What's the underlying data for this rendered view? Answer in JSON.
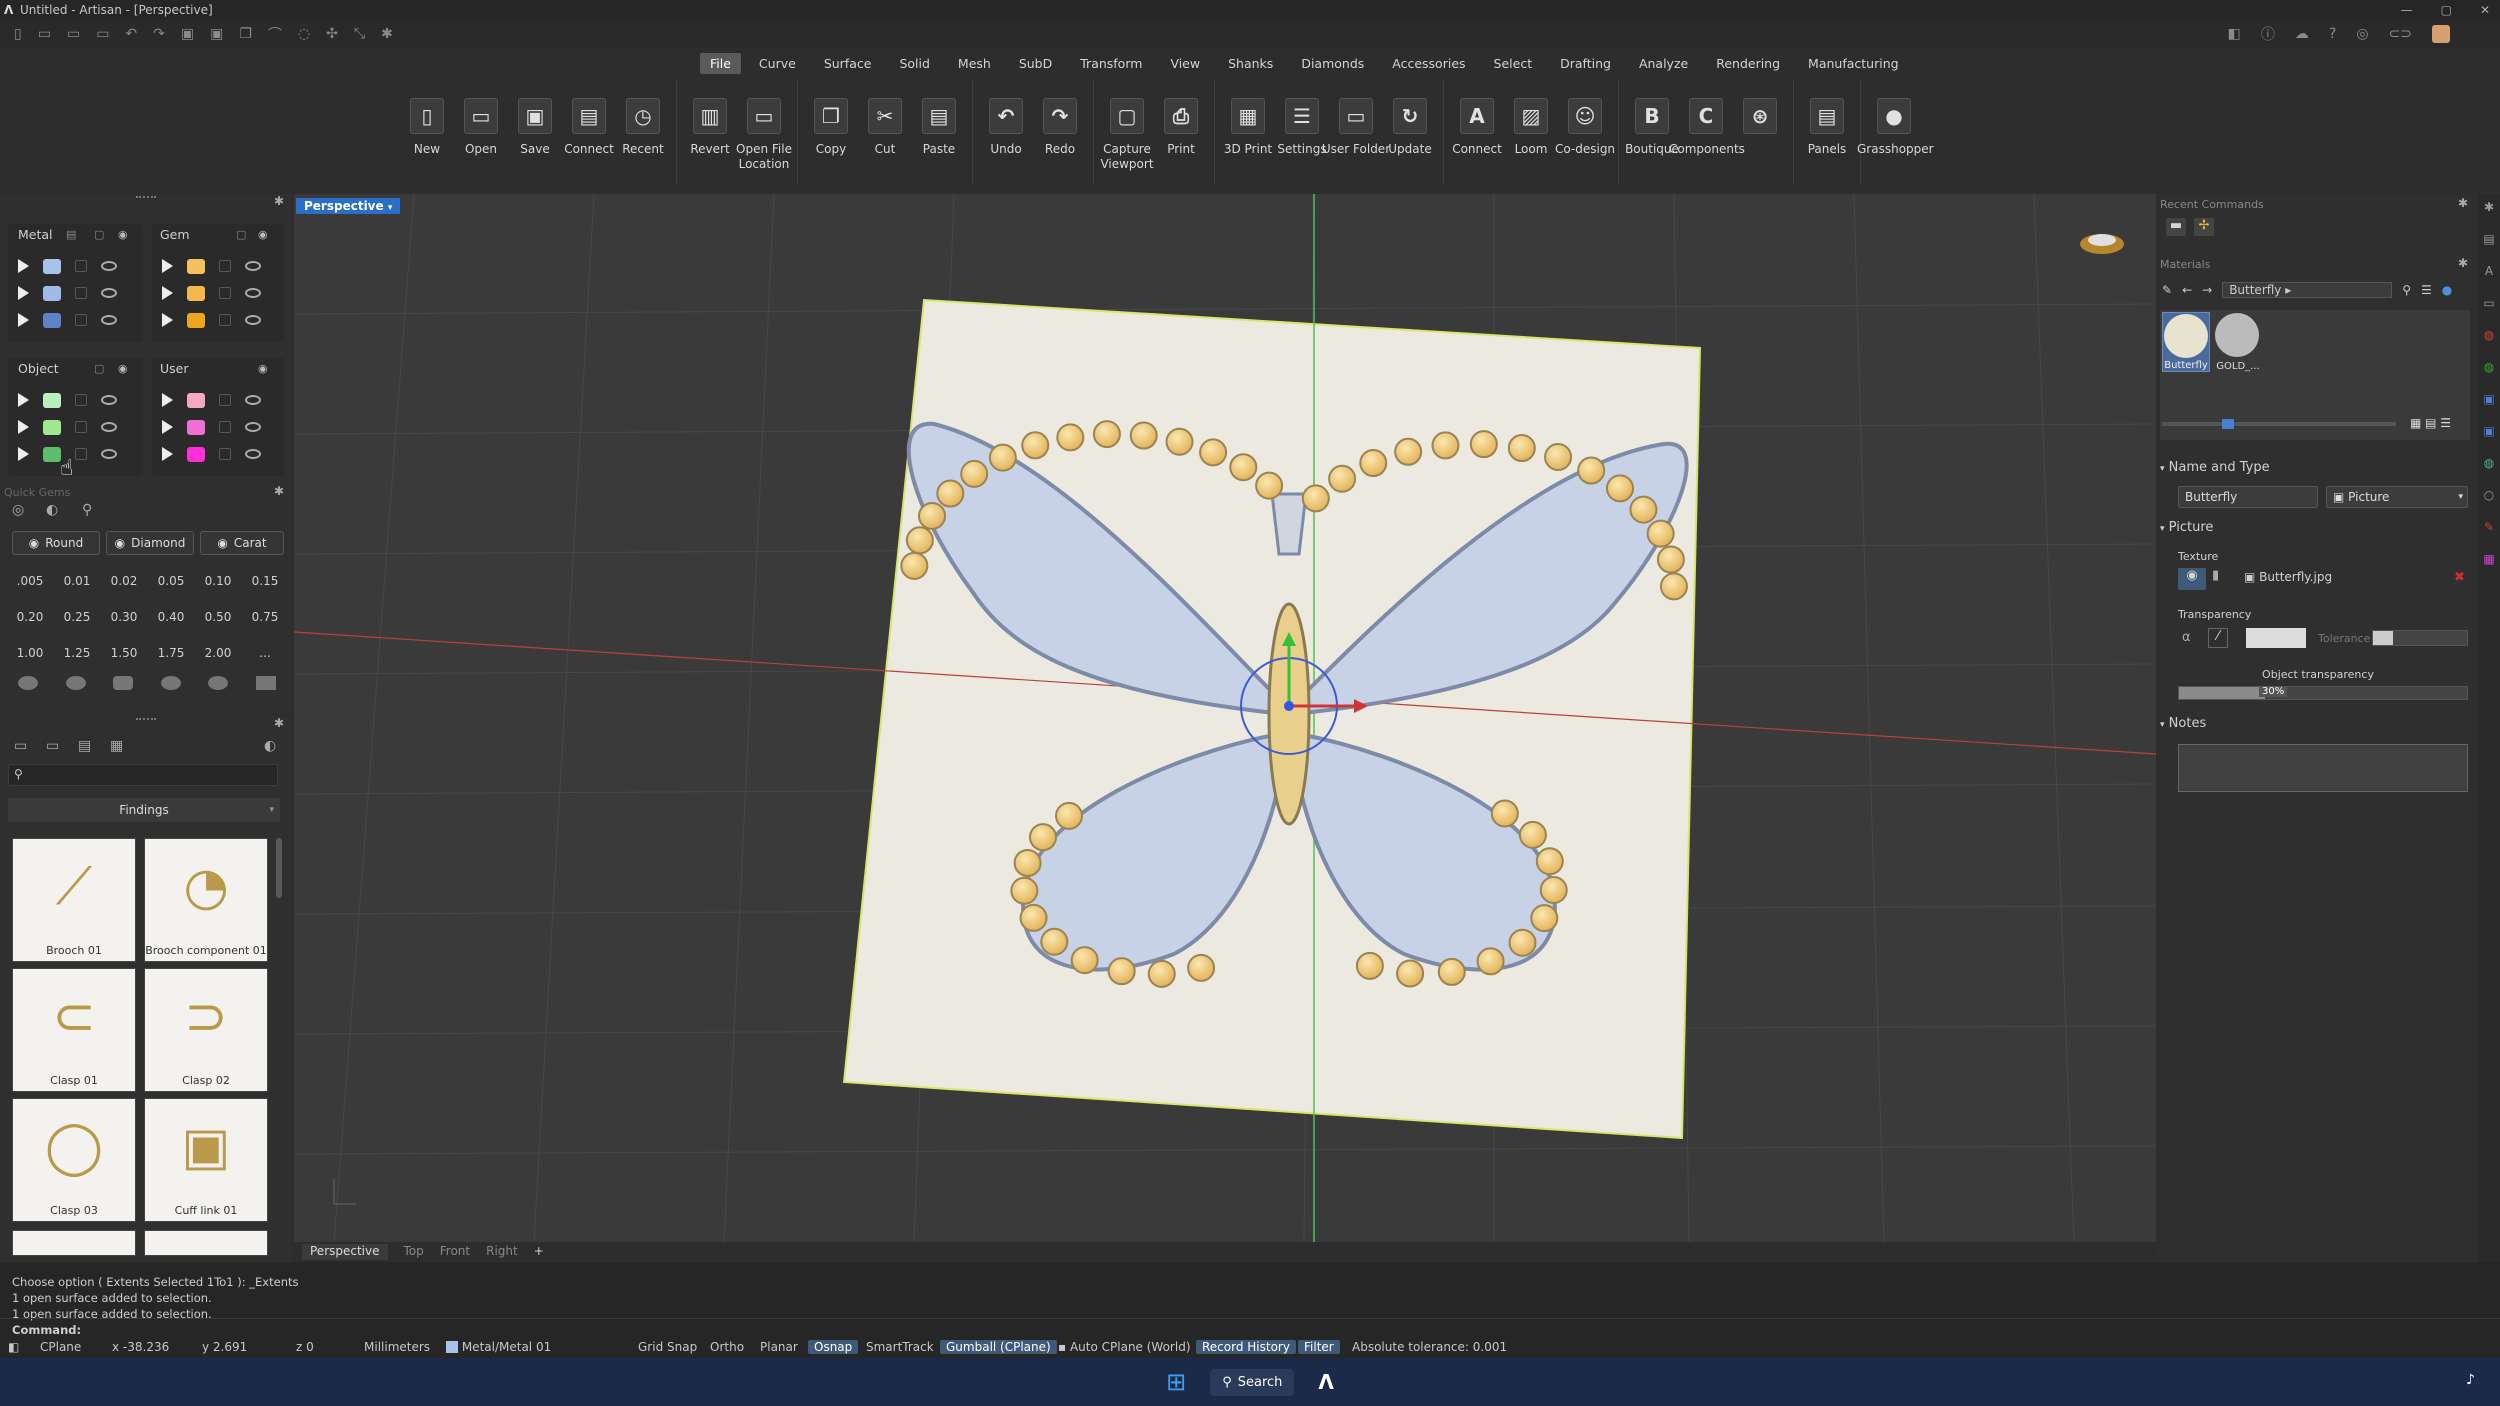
{
  "window": {
    "title": "Untitled - Artisan - [Perspective]"
  },
  "ribbon_tabs": [
    "File",
    "Curve",
    "Surface",
    "Solid",
    "Mesh",
    "SubD",
    "Transform",
    "View",
    "Shanks",
    "Diamonds",
    "Accessories",
    "Select",
    "Drafting",
    "Analyze",
    "Rendering",
    "Manufacturing"
  ],
  "ribbon_active": "File",
  "ribbon_buttons": [
    {
      "label": "New",
      "icon": "new-file-icon",
      "glyph": "▯"
    },
    {
      "label": "Open",
      "icon": "open-folder-icon",
      "glyph": "▭"
    },
    {
      "label": "Save",
      "icon": "save-icon",
      "glyph": "▣"
    },
    {
      "label": "Connect",
      "icon": "connect-icon",
      "glyph": "▤"
    },
    {
      "label": "Recent",
      "icon": "recent-icon",
      "glyph": "◷"
    },
    {
      "label": "Revert",
      "icon": "revert-icon",
      "glyph": "▥"
    },
    {
      "label": "Open File Location",
      "icon": "folder-location-icon",
      "glyph": "▭"
    },
    {
      "label": "Copy",
      "icon": "copy-icon",
      "glyph": "❐"
    },
    {
      "label": "Cut",
      "icon": "cut-icon",
      "glyph": "✂"
    },
    {
      "label": "Paste",
      "icon": "paste-icon",
      "glyph": "▤"
    },
    {
      "label": "Undo",
      "icon": "undo-icon",
      "glyph": "↶"
    },
    {
      "label": "Redo",
      "icon": "redo-icon",
      "glyph": "↷"
    },
    {
      "label": "Capture Viewport",
      "icon": "capture-icon",
      "glyph": "▢"
    },
    {
      "label": "Print",
      "icon": "print-icon",
      "glyph": "⎙"
    },
    {
      "label": "3D Print",
      "icon": "3d-print-icon",
      "glyph": "▦"
    },
    {
      "label": "Settings",
      "icon": "settings-icon",
      "glyph": "☰"
    },
    {
      "label": "User Folder",
      "icon": "user-folder-icon",
      "glyph": "▭"
    },
    {
      "label": "Update",
      "icon": "update-icon",
      "glyph": "↻"
    },
    {
      "label": "Connect",
      "icon": "artisan-connect-icon",
      "glyph": "A"
    },
    {
      "label": "Loom",
      "icon": "loom-icon",
      "glyph": "▨"
    },
    {
      "label": "Co-design",
      "icon": "co-design-icon",
      "glyph": "☺"
    },
    {
      "label": "Boutique",
      "icon": "boutique-icon",
      "glyph": "B"
    },
    {
      "label": "Components",
      "icon": "components-icon",
      "glyph": "C"
    },
    {
      "label": "",
      "icon": "tax-icon",
      "glyph": "⊛"
    },
    {
      "label": "Panels",
      "icon": "panels-icon",
      "glyph": "▤"
    },
    {
      "label": "Grasshopper",
      "icon": "grasshopper-icon",
      "glyph": "●"
    }
  ],
  "layers": {
    "metal": {
      "title": "Metal",
      "colors": [
        "#a9c2ea",
        "#9fbbe6",
        "#5f83c9"
      ]
    },
    "gem": {
      "title": "Gem",
      "colors": [
        "#f3c15e",
        "#f3b74a",
        "#eea51f"
      ]
    },
    "object": {
      "title": "Object",
      "colors": [
        "#b8f0c0",
        "#9ee88f",
        "#5bbf6a"
      ]
    },
    "user": {
      "title": "User",
      "colors": [
        "#f4a8c4",
        "#f06fd4",
        "#ff2ed6"
      ]
    }
  },
  "quick_gems": {
    "label": "Quick Gems",
    "shapes": [
      "Round",
      "Diamond",
      "Carat"
    ],
    "carats": [
      ".005",
      "0.01",
      "0.02",
      "0.05",
      "0.10",
      "0.15",
      "0.20",
      "0.25",
      "0.30",
      "0.40",
      "0.50",
      "0.75",
      "1.00",
      "1.25",
      "1.50",
      "1.75",
      "2.00",
      "..."
    ]
  },
  "library": {
    "category": "Findings",
    "search_placeholder": "",
    "items": [
      "Brooch 01",
      "Brooch component 01",
      "Clasp 01",
      "Clasp 02",
      "Clasp 03",
      "Cuff link 01"
    ]
  },
  "viewport": {
    "name": "Perspective",
    "tabs": [
      "Perspective",
      "Top",
      "Front",
      "Right"
    ]
  },
  "right_panel": {
    "recent_commands": "Recent Commands",
    "materials": "Materials",
    "breadcrumb": "Butterfly",
    "thumbs": [
      "Butterfly",
      "GOLD_..."
    ],
    "name_and_type": "Name and Type",
    "name_value": "Butterfly",
    "type_value": "Picture",
    "picture": "Picture",
    "texture": "Texture",
    "texture_file": "Butterfly.jpg",
    "transparency": "Transparency",
    "tolerance": "Tolerance",
    "object_transparency": "Object transparency",
    "object_transparency_value": "30%",
    "notes": "Notes"
  },
  "command_history": [
    "Choose option ( Extents  Selected  1To1 ): _Extents",
    "1 open surface added to selection.",
    "1 open surface added to selection."
  ],
  "command_prompt": "Command:",
  "status_bar": {
    "cplane": "CPlane",
    "x": "x -38.236",
    "y": "y 2.691",
    "z": "z 0",
    "units": "Millimeters",
    "layer": "Metal/Metal 01",
    "grid_snap": "Grid Snap",
    "ortho": "Ortho",
    "planar": "Planar",
    "osnap": "Osnap",
    "smarttrack": "SmartTrack",
    "gumball": "Gumball (CPlane)",
    "auto_cplane": "Auto CPlane (World)",
    "record_history": "Record History",
    "filter": "Filter",
    "tolerance": "Absolute tolerance: 0.001"
  },
  "taskbar": {
    "search": "Search"
  }
}
